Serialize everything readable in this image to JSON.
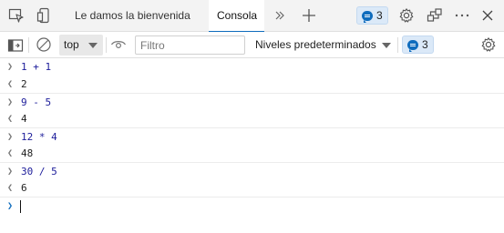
{
  "tabs": {
    "welcome_label": "Le damos la bienvenida",
    "console_label": "Consola",
    "more_tabs_icon": "double-chevron-icon",
    "add_tab_icon": "plus-icon"
  },
  "header": {
    "issues_count": "3"
  },
  "toolbar": {
    "context": "top",
    "filter_placeholder": "Filtro",
    "levels_label": "Niveles predeterminados",
    "issues_count": "3"
  },
  "console": {
    "entries": [
      {
        "type": "input",
        "text": "1 + 1"
      },
      {
        "type": "output",
        "text": "2"
      },
      {
        "type": "input",
        "text": "9 - 5"
      },
      {
        "type": "output",
        "text": "4"
      },
      {
        "type": "input",
        "text": "12 * 4"
      },
      {
        "type": "output",
        "text": "48"
      },
      {
        "type": "input",
        "text": "30 / 5"
      },
      {
        "type": "output",
        "text": "6"
      }
    ]
  },
  "colors": {
    "accent": "#0f6cbd",
    "input_text": "#1c1c9a"
  }
}
